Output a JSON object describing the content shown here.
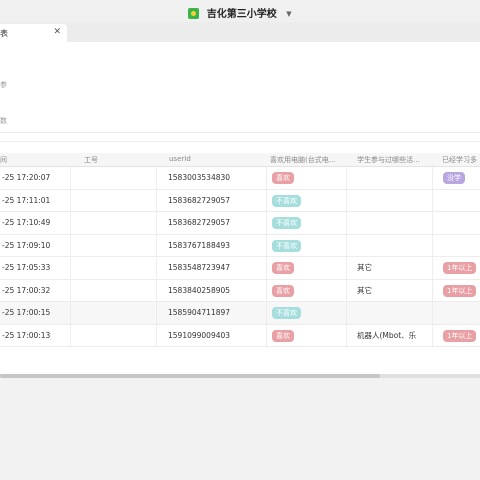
{
  "app": {
    "title": "吉化第三小学校"
  },
  "tab": {
    "label": "表",
    "close": "✕"
  },
  "info": {
    "line1": "参",
    "line2": "数"
  },
  "table": {
    "columns": [
      "间",
      "工号",
      "userId",
      "喜欢用电脑(台式电…",
      "学生参与过哪些活…",
      "已经学习多"
    ],
    "rows": [
      {
        "time": "-25 17:20:07",
        "job": "",
        "userId": "1583003534830",
        "like": "喜欢",
        "activity": "",
        "grade": "没学"
      },
      {
        "time": "-25 17:11:01",
        "job": "",
        "userId": "1583682729057",
        "like": "不喜欢",
        "activity": "",
        "grade": ""
      },
      {
        "time": "-25 17:10:49",
        "job": "",
        "userId": "1583682729057",
        "like": "不喜欢",
        "activity": "",
        "grade": ""
      },
      {
        "time": "-25 17:09:10",
        "job": "",
        "userId": "1583767188493",
        "like": "不喜欢",
        "activity": "",
        "grade": ""
      },
      {
        "time": "-25 17:05:33",
        "job": "",
        "userId": "1583548723947",
        "like": "喜欢",
        "activity": "其它",
        "grade": "1年以上"
      },
      {
        "time": "-25 17:00:32",
        "job": "",
        "userId": "1583840258905",
        "like": "喜欢",
        "activity": "其它",
        "grade": "1年以上"
      },
      {
        "time": "-25 17:00:15",
        "job": "",
        "userId": "1585904711897",
        "like": "不喜欢",
        "activity": "",
        "grade": ""
      },
      {
        "time": "-25 17:00:13",
        "job": "",
        "userId": "1591099009403",
        "like": "喜欢",
        "activity": "机器人(Mbot、乐",
        "grade": "1年以上"
      }
    ]
  },
  "colors": {
    "like": "#e8a0a4",
    "dislike": "#a6dede",
    "learning": "#b7a6df"
  }
}
